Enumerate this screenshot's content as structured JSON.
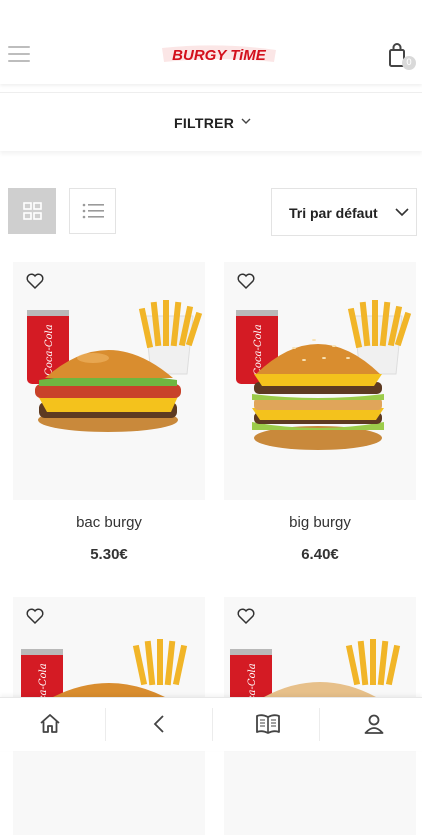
{
  "header": {
    "brand": "BURGY TiME",
    "menu_icon": "hamburger-menu-icon",
    "cart_icon": "shopping-bag-icon",
    "cart_count": "0",
    "brand_color": "#d3101c"
  },
  "filter": {
    "label": "FILTRER",
    "icon": "chevron-down-icon"
  },
  "toolbar": {
    "grid_view_icon": "grid-view-icon",
    "list_view_icon": "list-view-icon",
    "sort_label": "Tri par défaut",
    "sort_icon": "chevron-down-icon"
  },
  "products": [
    {
      "name": "bac burgy",
      "price": "5.30€"
    },
    {
      "name": "big burgy",
      "price": "6.40€"
    },
    {
      "name": "",
      "price": ""
    },
    {
      "name": "",
      "price": ""
    }
  ],
  "bottom_nav": {
    "items": [
      "home-icon",
      "back-icon",
      "menu-book-icon",
      "account-icon"
    ]
  }
}
